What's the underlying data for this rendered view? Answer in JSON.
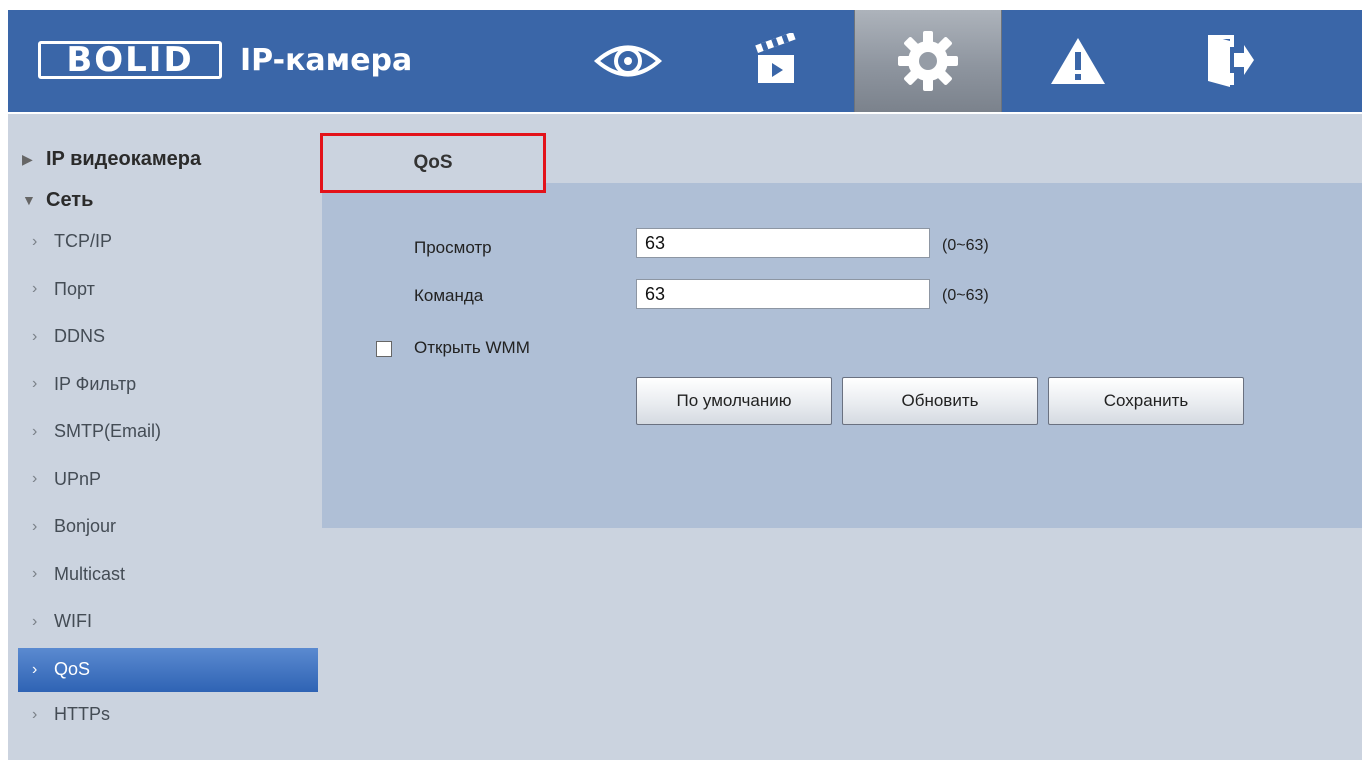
{
  "header": {
    "logo_text": "BOLID",
    "subtitle": "IP-камера",
    "nav": [
      {
        "icon": "eye-icon"
      },
      {
        "icon": "clapperboard-icon"
      },
      {
        "icon": "gear-icon"
      },
      {
        "icon": "warning-icon"
      },
      {
        "icon": "logout-icon"
      }
    ],
    "active_nav": "gear-icon"
  },
  "sidebar": {
    "groups": [
      {
        "label": "IP видеокамера",
        "expanded": false
      },
      {
        "label": "Сеть",
        "expanded": true
      }
    ],
    "items": [
      {
        "label": "TCP/IP"
      },
      {
        "label": "Порт"
      },
      {
        "label": "DDNS"
      },
      {
        "label": "IP Фильтр"
      },
      {
        "label": "SMTP(Email)"
      },
      {
        "label": "UPnP"
      },
      {
        "label": "Bonjour"
      },
      {
        "label": "Multicast"
      },
      {
        "label": "WIFI"
      },
      {
        "label": "QoS"
      },
      {
        "label": "HTTPs"
      }
    ],
    "selected": "QoS"
  },
  "tab": {
    "label": "QoS"
  },
  "form": {
    "fields": [
      {
        "label": "Просмотр",
        "value": "63",
        "range": "(0~63)"
      },
      {
        "label": "Команда",
        "value": "63",
        "range": "(0~63)"
      }
    ],
    "wmm": {
      "label": "Открыть WMM",
      "checked": false
    },
    "buttons": {
      "default": "По умолчанию",
      "refresh": "Обновить",
      "save": "Сохранить"
    }
  },
  "colors": {
    "header_bg": "#3a66a8",
    "page_bg": "#cbd3df",
    "panel_bg": "#afbfd6",
    "selected_item": "#2f63b4",
    "highlight_border": "#e3121a"
  }
}
